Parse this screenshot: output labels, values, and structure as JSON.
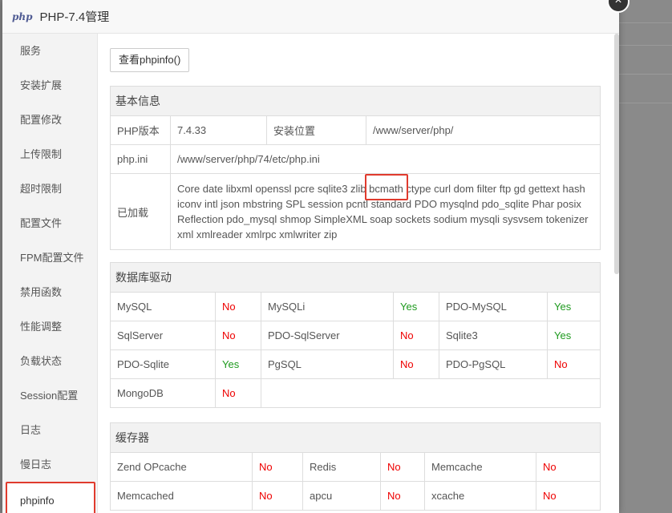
{
  "window": {
    "title": "PHP-7.4管理",
    "logo_text": "php"
  },
  "sidebar": {
    "items": [
      {
        "label": "服务"
      },
      {
        "label": "安装扩展"
      },
      {
        "label": "配置修改"
      },
      {
        "label": "上传限制"
      },
      {
        "label": "超时限制"
      },
      {
        "label": "配置文件"
      },
      {
        "label": "FPM配置文件"
      },
      {
        "label": "禁用函数"
      },
      {
        "label": "性能调整"
      },
      {
        "label": "负载状态"
      },
      {
        "label": "Session配置"
      },
      {
        "label": "日志"
      },
      {
        "label": "慢日志"
      },
      {
        "label": "phpinfo"
      }
    ],
    "active": "phpinfo"
  },
  "toolbar": {
    "view_phpinfo": "查看phpinfo()"
  },
  "basic": {
    "header": "基本信息",
    "version_label": "PHP版本",
    "version_value": "7.4.33",
    "install_label": "安装位置",
    "install_value": "/www/server/php/",
    "ini_label": "php.ini",
    "ini_value": "/www/server/php/74/etc/php.ini",
    "loaded_label": "已加载",
    "loaded_before": "Core date libxml openssl pcre sqlite3 zlib ",
    "loaded_highlight": "bcmath",
    "loaded_after": " ctype curl dom filter ftp gd gettext hash iconv intl json mbstring SPL session pcntl standard PDO mysqlnd pdo_sqlite Phar posix Reflection pdo_mysql shmop SimpleXML soap sockets sodium mysqli sysvsem tokenizer xml xmlreader xmlrpc xmlwriter zip"
  },
  "db": {
    "header": "数据库驱动",
    "rows": [
      [
        {
          "name": "MySQL",
          "status": "No"
        },
        {
          "name": "MySQLi",
          "status": "Yes"
        },
        {
          "name": "PDO-MySQL",
          "status": "Yes"
        }
      ],
      [
        {
          "name": "SqlServer",
          "status": "No"
        },
        {
          "name": "PDO-SqlServer",
          "status": "No"
        },
        {
          "name": "Sqlite3",
          "status": "Yes"
        }
      ],
      [
        {
          "name": "PDO-Sqlite",
          "status": "Yes"
        },
        {
          "name": "PgSQL",
          "status": "No"
        },
        {
          "name": "PDO-PgSQL",
          "status": "No"
        }
      ],
      [
        {
          "name": "MongoDB",
          "status": "No"
        }
      ]
    ]
  },
  "cache": {
    "header": "缓存器",
    "rows": [
      [
        {
          "name": "Zend OPcache",
          "status": "No"
        },
        {
          "name": "Redis",
          "status": "No"
        },
        {
          "name": "Memcache",
          "status": "No"
        }
      ],
      [
        {
          "name": "Memcached",
          "status": "No"
        },
        {
          "name": "apcu",
          "status": "No"
        },
        {
          "name": "xcache",
          "status": "No"
        }
      ]
    ]
  },
  "colors": {
    "yes": "#1e9a1e",
    "no": "#ee0000",
    "highlight_border": "#e03b2e"
  },
  "icons": {
    "close": "close-icon"
  },
  "close_glyph": "×"
}
